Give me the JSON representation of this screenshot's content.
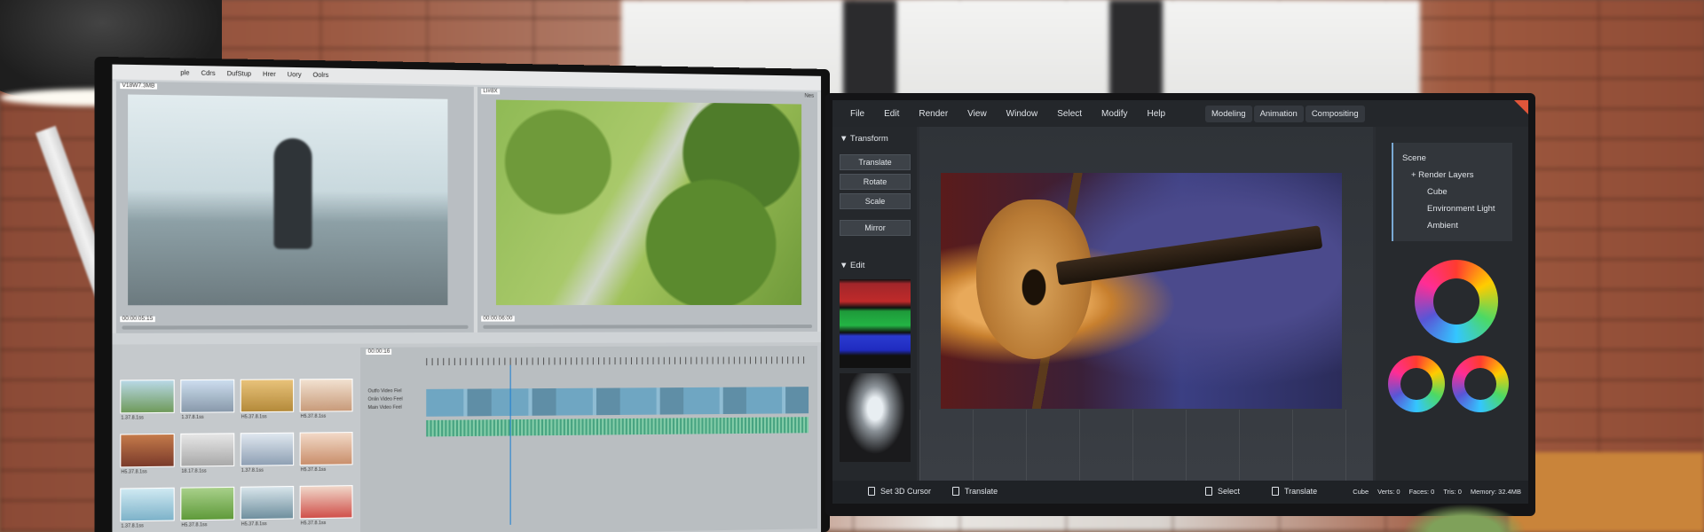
{
  "left_monitor": {
    "menubar": [
      "ple",
      "Cdrs",
      "DufStup",
      "Hrer",
      "Uory",
      "Oolrs"
    ],
    "viewer_a": {
      "label": "V18W7.3MB",
      "timecode": "00:00:05:15"
    },
    "viewer_b": {
      "label": "LI#8X",
      "corner": "Nes",
      "timecode": "00:00:06:00"
    },
    "clips": [
      "1.37.8.1ss",
      "1.37.8.1ss",
      "H5.37.8.1ss",
      "H5.37.8.1ss",
      "H5.37.8.1ss",
      "18.17.8.1ss",
      "1.37.8.1ss",
      "H5.37.8.1ss",
      "1.37.8.1ss",
      "H5.37.8.1ss",
      "H5.37.8.1ss",
      "H5.37.8.1ss"
    ],
    "timeline": {
      "timecode": "00:00:16",
      "tracks": [
        "Outfo Video Fiel",
        "Onlin Video Feel",
        "Main Video Feel"
      ]
    }
  },
  "right_monitor": {
    "menu": [
      "File",
      "Edit",
      "Render",
      "View",
      "Window",
      "Select",
      "Modify",
      "Help"
    ],
    "workspaces": [
      "Modeling",
      "Animation",
      "Compositing"
    ],
    "transform_panel": {
      "title": "▼ Transform",
      "buttons": [
        "Translate",
        "Rotate",
        "Scale",
        "Mirror"
      ]
    },
    "edit_panel": {
      "title": "▼ Edit"
    },
    "scene": {
      "root": "Scene",
      "render_layers": "+ Render Layers",
      "items": [
        "Cube",
        "Environment Light",
        "Ambient"
      ]
    },
    "statusbar": {
      "set_cursor": "Set 3D Cursor",
      "translate_1": "Translate",
      "select": "Select",
      "translate_2": "Translate",
      "stats": [
        "Cube",
        "Verts: 0",
        "Faces: 0",
        "Tris: 0",
        "Memory: 32.4MB"
      ]
    },
    "accent_color": "#e0563a"
  }
}
